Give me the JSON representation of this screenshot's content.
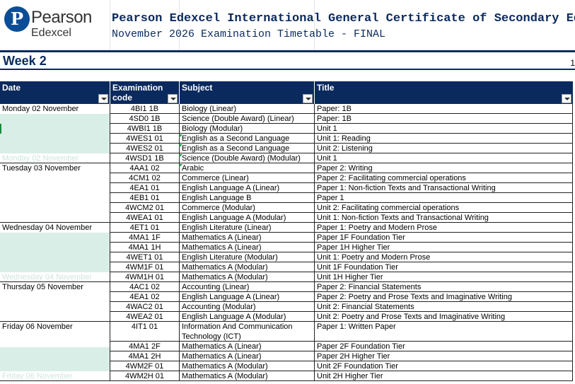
{
  "header": {
    "logo_word": "Pearson",
    "logo_sub": "Edexcel",
    "title": "Pearson Edexcel International General Certificate of Secondary Education",
    "subtitle": "November 2026 Examination Timetable - FINAL"
  },
  "week_label": "Week 2",
  "week_right": "1",
  "columns": {
    "date": "Date",
    "code": "Examination code",
    "subject": "Subject",
    "title": "Title"
  },
  "days": [
    {
      "label": "Monday 02 November",
      "ghost": "Monday 02 November"
    },
    {
      "label": "Tuesday 03 November",
      "ghost": ""
    },
    {
      "label": "Wednesday 04 November",
      "ghost": "Wednesday 04 November"
    },
    {
      "label": "Thursday 05 November",
      "ghost": ""
    },
    {
      "label": "Friday 06 November",
      "ghost": "Friday 06 November"
    }
  ],
  "rows": [
    {
      "code": "4BI1 1B",
      "subject": "Biology (Linear)",
      "title": "Paper: 1B"
    },
    {
      "code": "4SD0 1B",
      "subject": "Science (Double Award) (Linear)",
      "title": "Paper: 1B"
    },
    {
      "code": "4WBI1 1B",
      "subject": "Biology (Modular)",
      "title": "Unit 1"
    },
    {
      "code": "4WES1 01",
      "subject": "English as a Second Language",
      "title": "Unit 1: Reading"
    },
    {
      "code": "4WES2 01",
      "subject": "English as a Second Language",
      "title": "Unit 2: Listening"
    },
    {
      "code": "4WSD1 1B",
      "subject": "Science (Double Award) (Modular)",
      "title": "Unit 1"
    },
    {
      "code": "4AA1 02",
      "subject": "Arabic",
      "title": "Paper 2: Writing"
    },
    {
      "code": "4CM1 02",
      "subject": "Commerce (Linear)",
      "title": "Paper 2: Facilitating commercial operations"
    },
    {
      "code": "4EA1 01",
      "subject": "English Language A (Linear)",
      "title": "Paper 1: Non-fiction Texts and Transactional Writing"
    },
    {
      "code": "4EB1 01",
      "subject": "English Language B",
      "title": "Paper 1"
    },
    {
      "code": "4WCM2 01",
      "subject": "Commerce (Modular)",
      "title": "Unit 2: Facilitating commercial operations"
    },
    {
      "code": "4WEA1 01",
      "subject": "English Language A (Modular)",
      "title": "Unit 1: Non-fiction Texts and Transactional Writing"
    },
    {
      "code": "4ET1 01",
      "subject": "English Literature (Linear)",
      "title": "Paper 1: Poetry and Modern Prose"
    },
    {
      "code": "4MA1 1F",
      "subject": "Mathematics A (Linear)",
      "title": "Paper 1F Foundation Tier"
    },
    {
      "code": "4MA1 1H",
      "subject": "Mathematics A (Linear)",
      "title": "Paper 1H Higher Tier"
    },
    {
      "code": "4WET1 01",
      "subject": "English Literature (Modular)",
      "title": "Unit 1: Poetry and Modern Prose"
    },
    {
      "code": "4WM1F 01",
      "subject": "Mathematics A (Modular)",
      "title": "Unit 1F Foundation Tier"
    },
    {
      "code": "4WM1H 01",
      "subject": "Mathematics A (Modular)",
      "title": "Unit 1H Higher Tier"
    },
    {
      "code": "4AC1 02",
      "subject": "Accounting (Linear)",
      "title": "Paper 2: Financial Statements"
    },
    {
      "code": "4EA1 02",
      "subject": "English Language A (Linear)",
      "title": "Paper 2: Poetry and Prose Texts and Imaginative Writing"
    },
    {
      "code": "4WAC2 01",
      "subject": "Accounting (Modular)",
      "title": "Unit 2: Financial Statements"
    },
    {
      "code": "4WEA2 01",
      "subject": "English Language A (Modular)",
      "title": "Unit 2: Poetry and Prose Texts and Imaginative Writing"
    },
    {
      "code": "4IT1 01",
      "subject": "Information And Communication Technology (ICT)",
      "title": "Paper 1: Written Paper"
    },
    {
      "code": "4MA1 2F",
      "subject": "Mathematics A (Linear)",
      "title": "Paper 2F Foundation Tier"
    },
    {
      "code": "4MA1 2H",
      "subject": "Mathematics A (Linear)",
      "title": "Paper 2H Higher Tier"
    },
    {
      "code": "4WM2F 01",
      "subject": "Mathematics A (Modular)",
      "title": "Unit 2F Foundation Tier"
    },
    {
      "code": "4WM2H 01",
      "subject": "Mathematics A (Modular)",
      "title": "Unit 2H Higher Tier"
    }
  ],
  "colors": {
    "navy": "#0a2a5e",
    "fill": "#daeee8"
  }
}
